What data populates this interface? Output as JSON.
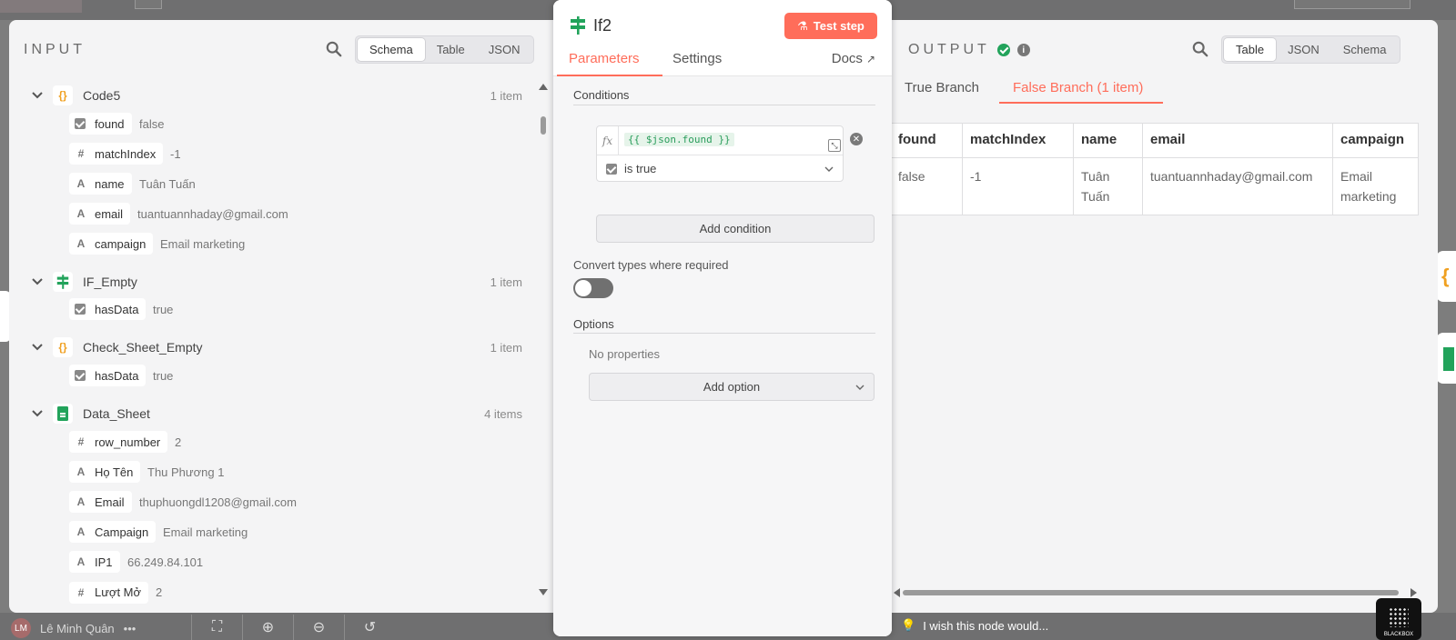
{
  "input": {
    "title": "INPUT",
    "view_tabs": [
      "Schema",
      "Table",
      "JSON"
    ],
    "active_view": "Schema",
    "nodes": [
      {
        "name": "Code5",
        "icon": "code-icon",
        "count": "1 item",
        "fields": [
          {
            "type": "boolean",
            "key": "found",
            "value": "false"
          },
          {
            "type": "number",
            "key": "matchIndex",
            "value": "-1"
          },
          {
            "type": "string",
            "key": "name",
            "value": "Tuân Tuấn"
          },
          {
            "type": "string",
            "key": "email",
            "value": "tuantuannhaday@gmail.com"
          },
          {
            "type": "string",
            "key": "campaign",
            "value": "Email marketing"
          }
        ]
      },
      {
        "name": "IF_Empty",
        "icon": "if-icon",
        "count": "1 item",
        "fields": [
          {
            "type": "boolean",
            "key": "hasData",
            "value": "true"
          }
        ]
      },
      {
        "name": "Check_Sheet_Empty",
        "icon": "code-icon",
        "count": "1 item",
        "fields": [
          {
            "type": "boolean",
            "key": "hasData",
            "value": "true"
          }
        ]
      },
      {
        "name": "Data_Sheet",
        "icon": "sheets-icon",
        "count": "4 items",
        "fields": [
          {
            "type": "number",
            "key": "row_number",
            "value": "2"
          },
          {
            "type": "string",
            "key": "Họ Tên",
            "value": "Thu Phương 1"
          },
          {
            "type": "string",
            "key": "Email",
            "value": "thuphuongdl1208@gmail.com"
          },
          {
            "type": "string",
            "key": "Campaign",
            "value": "Email marketing"
          },
          {
            "type": "string",
            "key": "IP1",
            "value": "66.249.84.101"
          },
          {
            "type": "number",
            "key": "Lượt Mở",
            "value": "2"
          }
        ]
      }
    ]
  },
  "node": {
    "title": "If2",
    "test_button": "Test step",
    "tabs": {
      "parameters": "Parameters",
      "settings": "Settings",
      "docs": "Docs"
    },
    "conditions_label": "Conditions",
    "expression": "{{ $json.found }}",
    "operator": "is true",
    "add_condition": "Add condition",
    "convert_label": "Convert types where required",
    "convert_enabled": false,
    "options_label": "Options",
    "no_properties": "No properties",
    "add_option": "Add option"
  },
  "output": {
    "title": "OUTPUT",
    "view_tabs": [
      "Table",
      "JSON",
      "Schema"
    ],
    "active_view": "Table",
    "branches": {
      "true_branch": "True Branch",
      "false_branch": "False Branch (1 item)"
    },
    "active_branch": "False Branch (1 item)",
    "columns": [
      "found",
      "matchIndex",
      "name",
      "email",
      "campaign"
    ],
    "rows": [
      [
        "false",
        "-1",
        "Tuân Tuấn",
        "tuantuannhaday@gmail.com",
        "Email marketing"
      ]
    ]
  },
  "footer": {
    "wish_text": "I wish this node would...",
    "user_name": "Lê Minh Quân",
    "brand": "BLACKBOX"
  },
  "colors": {
    "accent": "#ff6d5a",
    "success": "#22a35b",
    "code": "#f0a020"
  }
}
